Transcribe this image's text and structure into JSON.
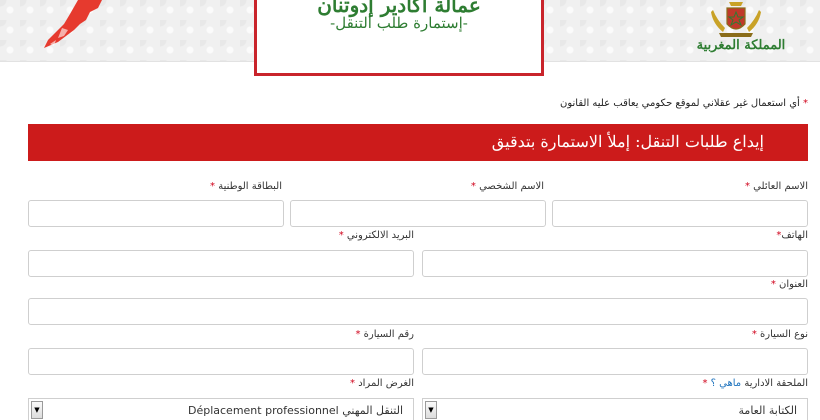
{
  "header": {
    "title_main": "عمالة أكادير إدوتنان",
    "title_sub": "-إستمارة طلب التنقل-",
    "kingdom": "المملكة المغربية"
  },
  "warning": {
    "star": "*",
    "text": "أي استعمال غير عقلاني لموقع حكومي يعاقب عليه القانون"
  },
  "banner": {
    "text": "إيداع طلبات التنقل: إملأ الاستمارة بتدقيق"
  },
  "form": {
    "family_name_label": "الاسم العائلي",
    "first_name_label": "الاسم الشخصي",
    "id_card_label": "البطاقة الوطنية",
    "phone_label": "الهاتف",
    "email_label": "البريد الالكتروني",
    "address_label": "العنوان",
    "car_type_label": "نوع السيارة",
    "car_number_label": "رقم السيارة",
    "annex_label": "الملحقة الادارية",
    "annex_help": "ماهي ؟",
    "purpose_label": "الغرض المراد",
    "annex_value": "الكتابة العامة",
    "purpose_value": "Déplacement professionnel التنقل المهني",
    "required_mark": "*"
  },
  "colors": {
    "banner": "#cc1b1b",
    "title_border": "#c9242b",
    "title_text": "#2e7d32",
    "required": "#d0021b",
    "link": "#1e73be"
  }
}
